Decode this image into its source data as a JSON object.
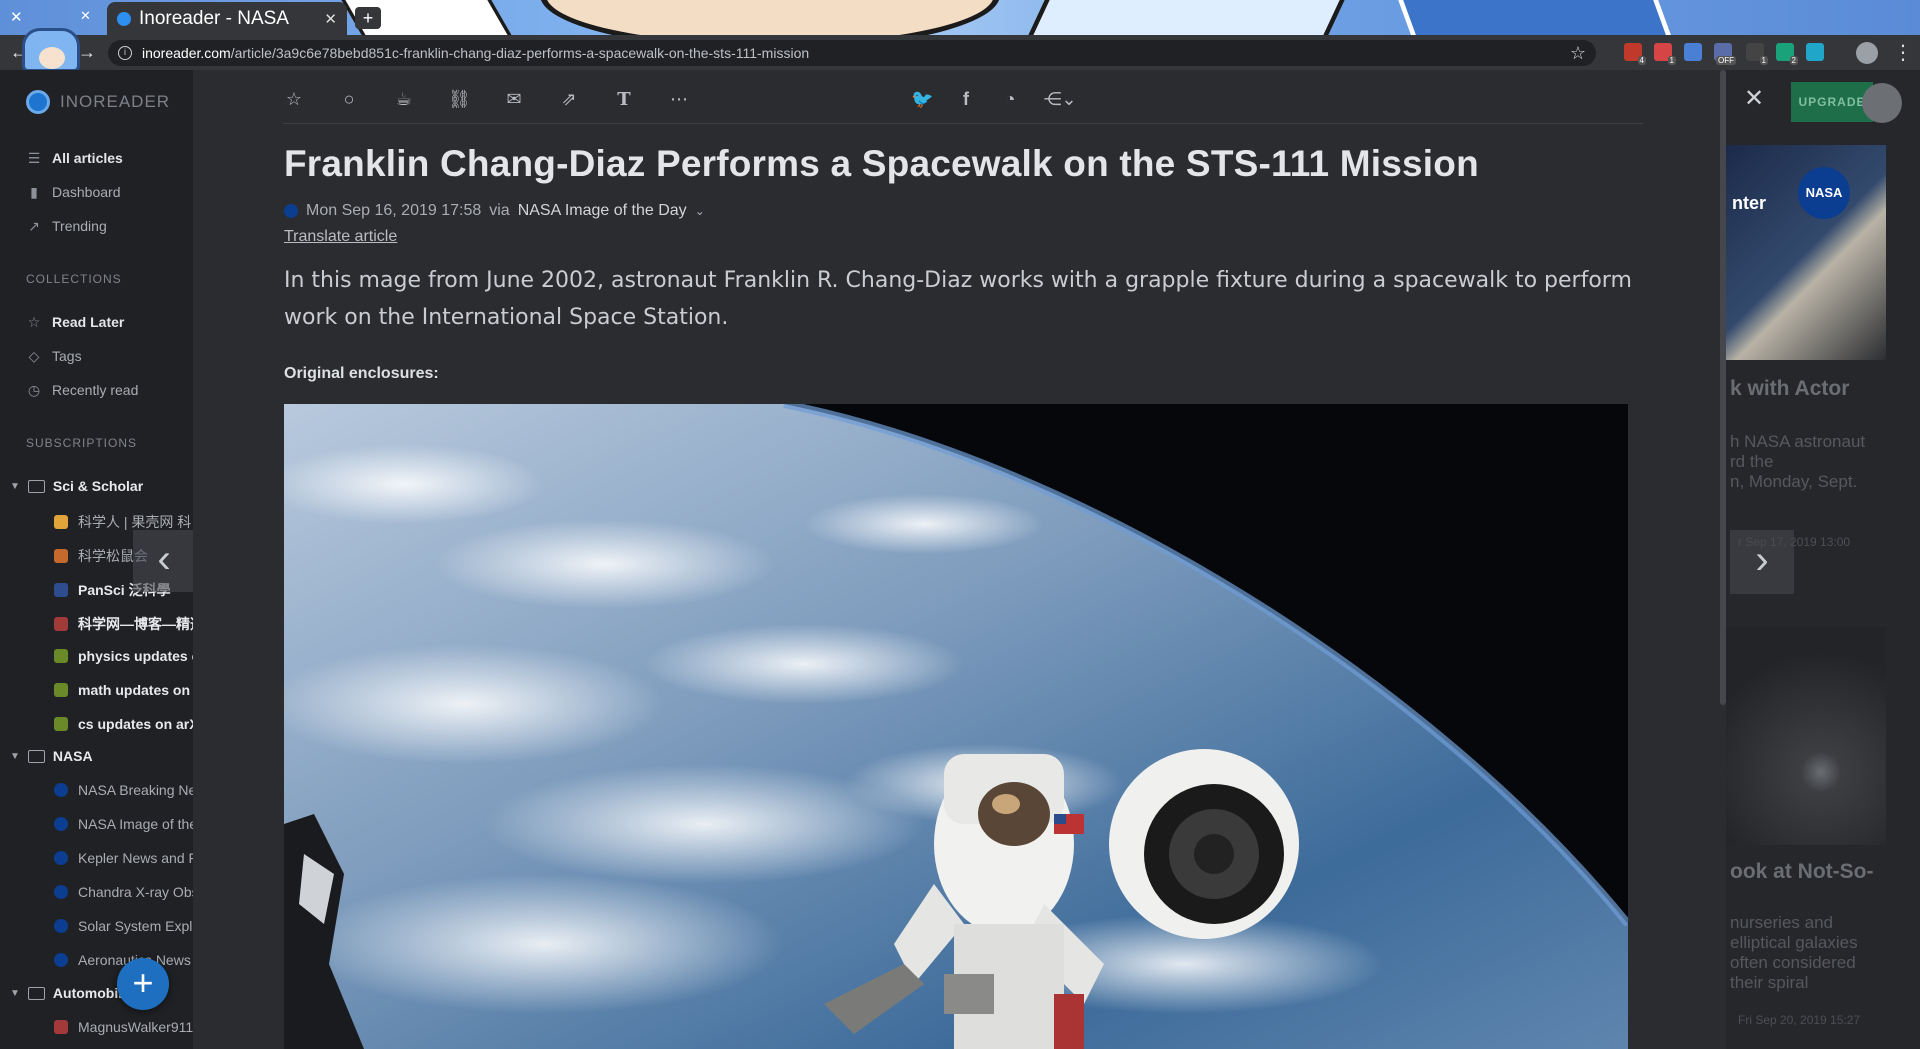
{
  "browser": {
    "tab_title": "Inoreader - NASA",
    "url_domain": "inoreader.com",
    "url_path": "/article/3a9c6e78bebd851c-franklin-chang-diaz-performs-a-spacewalk-on-the-sts-111-mission",
    "extensions": [
      {
        "name": "ublock-icon",
        "color": "#c0392b",
        "badge": "4"
      },
      {
        "name": "extension-red-icon",
        "color": "#d64545",
        "badge": "1"
      },
      {
        "name": "translate-icon",
        "color": "#4a7fd6"
      },
      {
        "name": "vpn-icon",
        "color": "#5b6da8",
        "badge": "OFF"
      },
      {
        "name": "extension-dark-icon",
        "color": "#444",
        "badge": "1"
      },
      {
        "name": "extension-green-icon",
        "color": "#1aa37a",
        "badge": "2"
      },
      {
        "name": "search-ext-icon",
        "color": "#1fa6c9"
      }
    ]
  },
  "sidebar": {
    "logo": "INOREADER",
    "nav": [
      {
        "label": "All articles",
        "icon": "list-icon",
        "bold": true
      },
      {
        "label": "Dashboard",
        "icon": "bar-chart-icon"
      },
      {
        "label": "Trending",
        "icon": "trending-icon"
      }
    ],
    "collections_heading": "COLLECTIONS",
    "collections": [
      {
        "label": "Read Later",
        "icon": "star-icon",
        "bold": true
      },
      {
        "label": "Tags",
        "icon": "tag-icon"
      },
      {
        "label": "Recently read",
        "icon": "clock-icon"
      }
    ],
    "subscriptions_heading": "SUBSCRIPTIONS",
    "folders": [
      {
        "label": "Sci & Scholar",
        "items": [
          {
            "label": "科学人 | 果壳网 科",
            "color": "#e0a43a"
          },
          {
            "label": "科学松鼠会",
            "color": "#c56a2d"
          },
          {
            "label": "PanSci 泛科學",
            "color": "#2d4d8f",
            "bold": true
          },
          {
            "label": "科学网—博客—精选",
            "color": "#a33a3a",
            "bold": true
          },
          {
            "label": "physics updates on arXiv",
            "color": "#6a8a2a",
            "bold": true
          },
          {
            "label": "math updates on arXiv",
            "color": "#6a8a2a",
            "bold": true
          },
          {
            "label": "cs updates on arXiv",
            "color": "#6a8a2a",
            "bold": true
          }
        ]
      },
      {
        "label": "NASA",
        "items": [
          {
            "label": "NASA Breaking News",
            "color": "#0b3d91"
          },
          {
            "label": "NASA Image of the Day",
            "color": "#0b3d91"
          },
          {
            "label": "Kepler News and Features",
            "color": "#0b3d91"
          },
          {
            "label": "Chandra X-ray Observatory",
            "color": "#0b3d91"
          },
          {
            "label": "Solar System Exploration",
            "color": "#0b3d91"
          },
          {
            "label": "Aeronautics News",
            "color": "#0b3d91"
          }
        ]
      },
      {
        "label": "Automobile",
        "items": [
          {
            "label": "MagnusWalker911",
            "color": "#a33a3a"
          }
        ]
      }
    ],
    "add_button": "+"
  },
  "header": {
    "upgrade_label": "UPGRADE"
  },
  "article": {
    "title": "Franklin Chang-Diaz Performs a Spacewalk on the STS-111 Mission",
    "date": "Mon Sep 16, 2019 17:58",
    "via": "via",
    "source": "NASA Image of the Day",
    "translate": "Translate article",
    "summary": "In this mage from June 2002, astronaut Franklin R. Chang-Diaz works with a grapple fixture during a spacewalk to perform work on the International Space Station.",
    "enclosures_label": "Original enclosures:"
  },
  "background_list": {
    "item1_thumb_text": "nter",
    "item1_title": "k with Actor",
    "item1_lines": [
      "h NASA astronaut",
      "rd the",
      "n, Monday, Sept."
    ],
    "item1_date": "r Sep 17, 2019 13:00",
    "item2_title": "ook at Not-So-",
    "item2_lines": [
      "nurseries and",
      "elliptical galaxies",
      "often considered",
      "their spiral"
    ],
    "item2_date": "Fri Sep 20, 2019 15:27"
  }
}
